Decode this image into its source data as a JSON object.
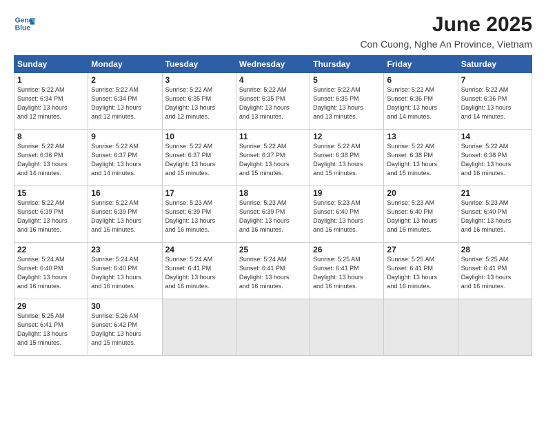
{
  "logo": {
    "line1": "General",
    "line2": "Blue"
  },
  "title": "June 2025",
  "subtitle": "Con Cuong, Nghe An Province, Vietnam",
  "headers": [
    "Sunday",
    "Monday",
    "Tuesday",
    "Wednesday",
    "Thursday",
    "Friday",
    "Saturday"
  ],
  "weeks": [
    [
      {
        "day": "1",
        "sunrise": "5:22 AM",
        "sunset": "6:34 PM",
        "daylight": "13 hours and 12 minutes."
      },
      {
        "day": "2",
        "sunrise": "5:22 AM",
        "sunset": "6:34 PM",
        "daylight": "13 hours and 12 minutes."
      },
      {
        "day": "3",
        "sunrise": "5:22 AM",
        "sunset": "6:35 PM",
        "daylight": "13 hours and 12 minutes."
      },
      {
        "day": "4",
        "sunrise": "5:22 AM",
        "sunset": "6:35 PM",
        "daylight": "13 hours and 13 minutes."
      },
      {
        "day": "5",
        "sunrise": "5:22 AM",
        "sunset": "6:35 PM",
        "daylight": "13 hours and 13 minutes."
      },
      {
        "day": "6",
        "sunrise": "5:22 AM",
        "sunset": "6:36 PM",
        "daylight": "13 hours and 14 minutes."
      },
      {
        "day": "7",
        "sunrise": "5:22 AM",
        "sunset": "6:36 PM",
        "daylight": "13 hours and 14 minutes."
      }
    ],
    [
      {
        "day": "8",
        "sunrise": "5:22 AM",
        "sunset": "6:36 PM",
        "daylight": "13 hours and 14 minutes."
      },
      {
        "day": "9",
        "sunrise": "5:22 AM",
        "sunset": "6:37 PM",
        "daylight": "13 hours and 14 minutes."
      },
      {
        "day": "10",
        "sunrise": "5:22 AM",
        "sunset": "6:37 PM",
        "daylight": "13 hours and 15 minutes."
      },
      {
        "day": "11",
        "sunrise": "5:22 AM",
        "sunset": "6:37 PM",
        "daylight": "13 hours and 15 minutes."
      },
      {
        "day": "12",
        "sunrise": "5:22 AM",
        "sunset": "6:38 PM",
        "daylight": "13 hours and 15 minutes."
      },
      {
        "day": "13",
        "sunrise": "5:22 AM",
        "sunset": "6:38 PM",
        "daylight": "13 hours and 15 minutes."
      },
      {
        "day": "14",
        "sunrise": "5:22 AM",
        "sunset": "6:38 PM",
        "daylight": "13 hours and 16 minutes."
      }
    ],
    [
      {
        "day": "15",
        "sunrise": "5:22 AM",
        "sunset": "6:39 PM",
        "daylight": "13 hours and 16 minutes."
      },
      {
        "day": "16",
        "sunrise": "5:22 AM",
        "sunset": "6:39 PM",
        "daylight": "13 hours and 16 minutes."
      },
      {
        "day": "17",
        "sunrise": "5:23 AM",
        "sunset": "6:39 PM",
        "daylight": "13 hours and 16 minutes."
      },
      {
        "day": "18",
        "sunrise": "5:23 AM",
        "sunset": "6:39 PM",
        "daylight": "13 hours and 16 minutes."
      },
      {
        "day": "19",
        "sunrise": "5:23 AM",
        "sunset": "6:40 PM",
        "daylight": "13 hours and 16 minutes."
      },
      {
        "day": "20",
        "sunrise": "5:23 AM",
        "sunset": "6:40 PM",
        "daylight": "13 hours and 16 minutes."
      },
      {
        "day": "21",
        "sunrise": "5:23 AM",
        "sunset": "6:40 PM",
        "daylight": "13 hours and 16 minutes."
      }
    ],
    [
      {
        "day": "22",
        "sunrise": "5:24 AM",
        "sunset": "6:40 PM",
        "daylight": "13 hours and 16 minutes."
      },
      {
        "day": "23",
        "sunrise": "5:24 AM",
        "sunset": "6:40 PM",
        "daylight": "13 hours and 16 minutes."
      },
      {
        "day": "24",
        "sunrise": "5:24 AM",
        "sunset": "6:41 PM",
        "daylight": "13 hours and 16 minutes."
      },
      {
        "day": "25",
        "sunrise": "5:24 AM",
        "sunset": "6:41 PM",
        "daylight": "13 hours and 16 minutes."
      },
      {
        "day": "26",
        "sunrise": "5:25 AM",
        "sunset": "6:41 PM",
        "daylight": "13 hours and 16 minutes."
      },
      {
        "day": "27",
        "sunrise": "5:25 AM",
        "sunset": "6:41 PM",
        "daylight": "13 hours and 16 minutes."
      },
      {
        "day": "28",
        "sunrise": "5:25 AM",
        "sunset": "6:41 PM",
        "daylight": "13 hours and 16 minutes."
      }
    ],
    [
      {
        "day": "29",
        "sunrise": "5:25 AM",
        "sunset": "6:41 PM",
        "daylight": "13 hours and 15 minutes."
      },
      {
        "day": "30",
        "sunrise": "5:26 AM",
        "sunset": "6:42 PM",
        "daylight": "13 hours and 15 minutes."
      },
      null,
      null,
      null,
      null,
      null
    ]
  ]
}
